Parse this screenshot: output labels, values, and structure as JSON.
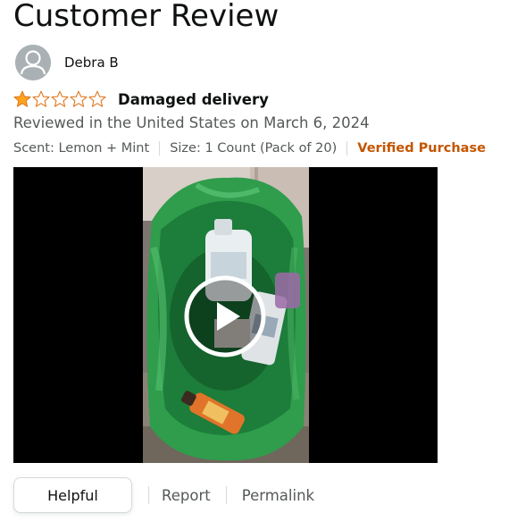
{
  "page": {
    "title": "Customer Review"
  },
  "reviewer": {
    "name": "Debra B",
    "avatar_icon": "user-silhouette-icon"
  },
  "review": {
    "rating": 1,
    "rating_max": 5,
    "title": "Damaged delivery",
    "date_line": "Reviewed in the United States on March 6, 2024",
    "format": {
      "scent": "Scent: Lemon + Mint",
      "size": "Size: 1 Count (Pack of 20)",
      "verified": "Verified Purchase"
    }
  },
  "media": {
    "type": "video",
    "play_icon": "play-icon"
  },
  "actions": {
    "helpful_label": "Helpful",
    "report_label": "Report",
    "permalink_label": "Permalink"
  },
  "colors": {
    "star_filled": "#ffa41c",
    "star_outline": "#de7921",
    "verified": "#c45500",
    "secondary_text": "#565959"
  }
}
